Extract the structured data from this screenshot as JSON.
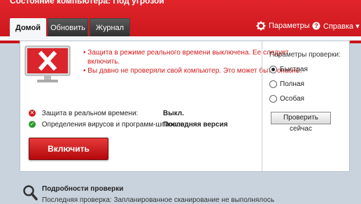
{
  "window": {
    "title": "Состояние компьютера: Под угрозой"
  },
  "tabs": [
    {
      "label": "Домой",
      "active": true
    },
    {
      "label": "Обновить",
      "active": false
    },
    {
      "label": "Журнал",
      "active": false
    }
  ],
  "header": {
    "settings_label": "Параметры",
    "help_label": "Справка ▾"
  },
  "alert": {
    "line1": "• Защита в режиме реального времени выключена. Ее следует",
    "line1b": "включить.",
    "line2": "• Вы давно не проверяли свой компьютер. Это может быть опасно."
  },
  "status": [
    {
      "label": "Защита в реальном времени:",
      "value": "Выкл.",
      "state": "error"
    },
    {
      "label": "Определения вирусов и программ-шпионов:",
      "value": "Последняя версия",
      "state": "ok"
    }
  ],
  "enable_button": "Включить",
  "scan_options": {
    "title": "Параметры проверки:",
    "options": [
      {
        "label": "Быстрая",
        "selected": true
      },
      {
        "label": "Полная",
        "selected": false
      },
      {
        "label": "Особая",
        "selected": false
      }
    ],
    "scan_button": "Проверить сейчас"
  },
  "details": {
    "title": "Подробности проверки",
    "last_scan": "Последняя проверка: Запланированное сканирование не выполнялось"
  },
  "colors": {
    "accent_red": "#d21a1a",
    "ok_green": "#2e9a2e",
    "title_bar": "#d51d23"
  }
}
